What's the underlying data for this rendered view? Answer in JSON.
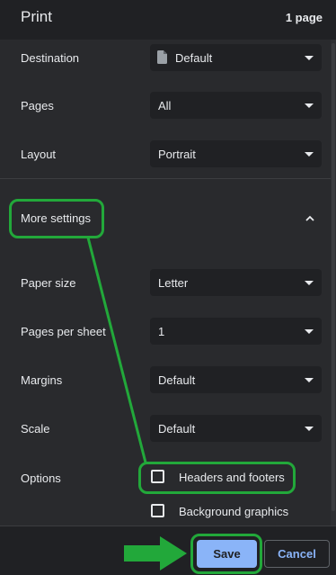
{
  "header": {
    "title": "Print",
    "page_count": "1 page"
  },
  "settings": {
    "destination": {
      "label": "Destination",
      "value": "Default",
      "icon": "document-icon"
    },
    "pages": {
      "label": "Pages",
      "value": "All"
    },
    "layout": {
      "label": "Layout",
      "value": "Portrait"
    }
  },
  "more_settings": {
    "label": "More settings",
    "state": "expanded",
    "icon": "chevron-up-icon"
  },
  "advanced": {
    "paper_size": {
      "label": "Paper size",
      "value": "Letter"
    },
    "pages_per_sheet": {
      "label": "Pages per sheet",
      "value": "1"
    },
    "margins": {
      "label": "Margins",
      "value": "Default"
    },
    "scale": {
      "label": "Scale",
      "value": "Default"
    },
    "options": {
      "label": "Options",
      "headers_footers": {
        "label": "Headers and footers",
        "checked": false
      },
      "background_graphics": {
        "label": "Background graphics",
        "checked": false
      }
    }
  },
  "footer": {
    "save_label": "Save",
    "cancel_label": "Cancel"
  },
  "colors": {
    "background": "#292a2d",
    "header": "#202124",
    "accent": "#8ab4f8",
    "annotation": "#22a83a"
  }
}
